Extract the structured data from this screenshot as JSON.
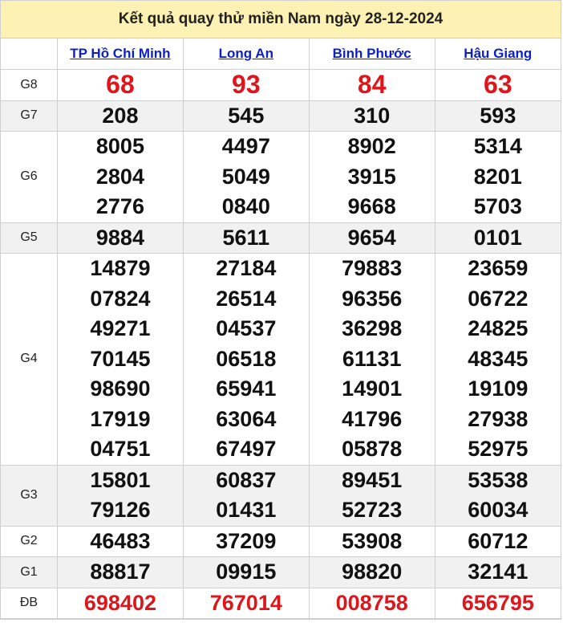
{
  "title": "Kết quả quay thử miền Nam ngày 28-12-2024",
  "provinces": [
    "TP Hồ Chí Minh",
    "Long An",
    "Bình Phước",
    "Hậu Giang"
  ],
  "prizes": [
    {
      "label": "G8",
      "values": [
        [
          "68"
        ],
        [
          "93"
        ],
        [
          "84"
        ],
        [
          "63"
        ]
      ]
    },
    {
      "label": "G7",
      "values": [
        [
          "208"
        ],
        [
          "545"
        ],
        [
          "310"
        ],
        [
          "593"
        ]
      ]
    },
    {
      "label": "G6",
      "values": [
        [
          "8005",
          "2804",
          "2776"
        ],
        [
          "4497",
          "5049",
          "0840"
        ],
        [
          "8902",
          "3915",
          "9668"
        ],
        [
          "5314",
          "8201",
          "5703"
        ]
      ]
    },
    {
      "label": "G5",
      "values": [
        [
          "9884"
        ],
        [
          "5611"
        ],
        [
          "9654"
        ],
        [
          "0101"
        ]
      ]
    },
    {
      "label": "G4",
      "values": [
        [
          "14879",
          "07824",
          "49271",
          "70145",
          "98690",
          "17919",
          "04751"
        ],
        [
          "27184",
          "26514",
          "04537",
          "06518",
          "65941",
          "63064",
          "67497"
        ],
        [
          "79883",
          "96356",
          "36298",
          "61131",
          "14901",
          "41796",
          "05878"
        ],
        [
          "23659",
          "06722",
          "24825",
          "48345",
          "19109",
          "27938",
          "52975"
        ]
      ]
    },
    {
      "label": "G3",
      "values": [
        [
          "15801",
          "79126"
        ],
        [
          "60837",
          "01431"
        ],
        [
          "89451",
          "52723"
        ],
        [
          "53538",
          "60034"
        ]
      ]
    },
    {
      "label": "G2",
      "values": [
        [
          "46483"
        ],
        [
          "37209"
        ],
        [
          "53908"
        ],
        [
          "60712"
        ]
      ]
    },
    {
      "label": "G1",
      "values": [
        [
          "88817"
        ],
        [
          "09915"
        ],
        [
          "98820"
        ],
        [
          "32141"
        ]
      ]
    },
    {
      "label": "ĐB",
      "values": [
        [
          "698402"
        ],
        [
          "767014"
        ],
        [
          "008758"
        ],
        [
          "656795"
        ]
      ]
    }
  ],
  "colors": {
    "highlight_number": "#e0151b",
    "link": "#0b1ec7",
    "title_bg": "#fdf1b3"
  }
}
